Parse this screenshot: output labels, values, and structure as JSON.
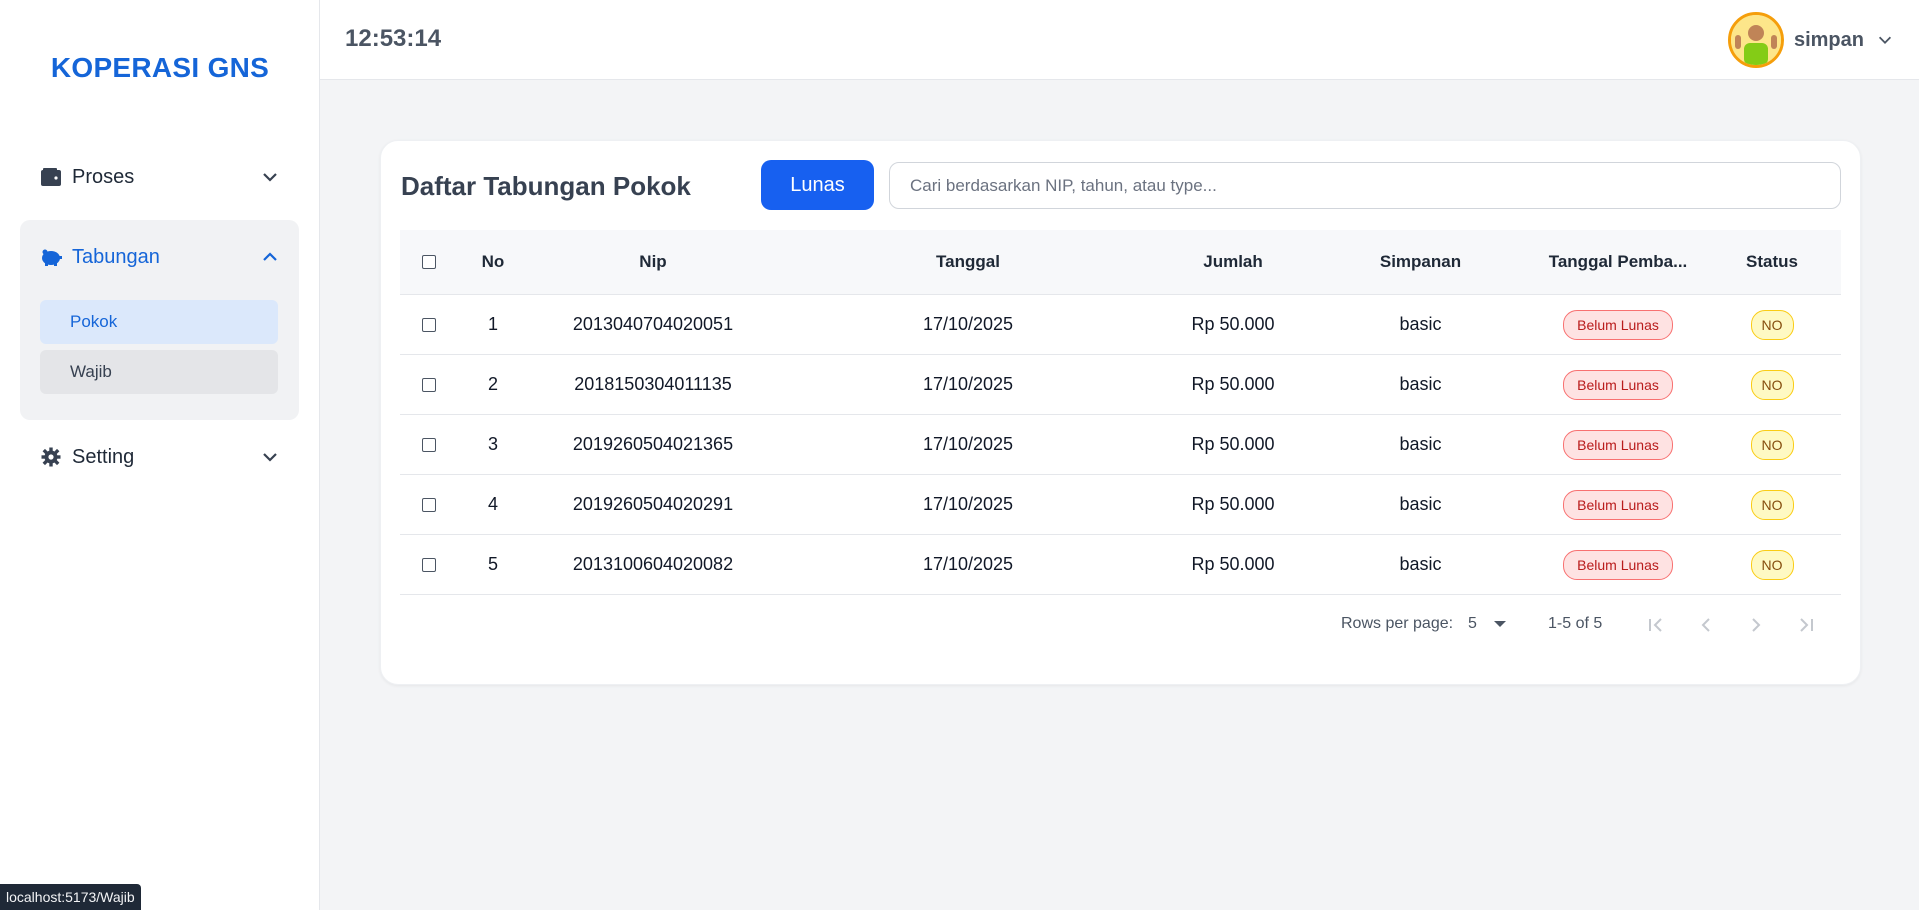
{
  "brand": "KOPERASI GNS",
  "header": {
    "clock": "12:53:14",
    "username": "simpan"
  },
  "sidebar": {
    "proses": "Proses",
    "tabungan": "Tabungan",
    "pokok": "Pokok",
    "wajib": "Wajib",
    "setting": "Setting"
  },
  "card": {
    "title": "Daftar Tabungan Pokok",
    "lunas_label": "Lunas",
    "search_placeholder": "Cari berdasarkan NIP, tahun, atau type..."
  },
  "table": {
    "columns": [
      "No",
      "Nip",
      "Tanggal",
      "Jumlah",
      "Simpanan",
      "Tanggal Pemba...",
      "Status"
    ],
    "rows": [
      {
        "no": "1",
        "nip": "2013040704020051",
        "tanggal": "17/10/2025",
        "jumlah": "Rp 50.000",
        "simpanan": "basic",
        "tanggal_bayar": "Belum Lunas",
        "status": "NO"
      },
      {
        "no": "2",
        "nip": "2018150304011135",
        "tanggal": "17/10/2025",
        "jumlah": "Rp 50.000",
        "simpanan": "basic",
        "tanggal_bayar": "Belum Lunas",
        "status": "NO"
      },
      {
        "no": "3",
        "nip": "2019260504021365",
        "tanggal": "17/10/2025",
        "jumlah": "Rp 50.000",
        "simpanan": "basic",
        "tanggal_bayar": "Belum Lunas",
        "status": "NO"
      },
      {
        "no": "4",
        "nip": "2019260504020291",
        "tanggal": "17/10/2025",
        "jumlah": "Rp 50.000",
        "simpanan": "basic",
        "tanggal_bayar": "Belum Lunas",
        "status": "NO"
      },
      {
        "no": "5",
        "nip": "2013100604020082",
        "tanggal": "17/10/2025",
        "jumlah": "Rp 50.000",
        "simpanan": "basic",
        "tanggal_bayar": "Belum Lunas",
        "status": "NO"
      }
    ]
  },
  "pagination": {
    "rows_per_page_label": "Rows per page:",
    "rows_per_page": "5",
    "range": "1-5 of 5"
  },
  "statusbar": "localhost:5173/Wajib",
  "colors": {
    "accent": "#1565d8",
    "button": "#1760f0",
    "badge_red": "#f87171",
    "badge_yellow": "#facc15"
  }
}
